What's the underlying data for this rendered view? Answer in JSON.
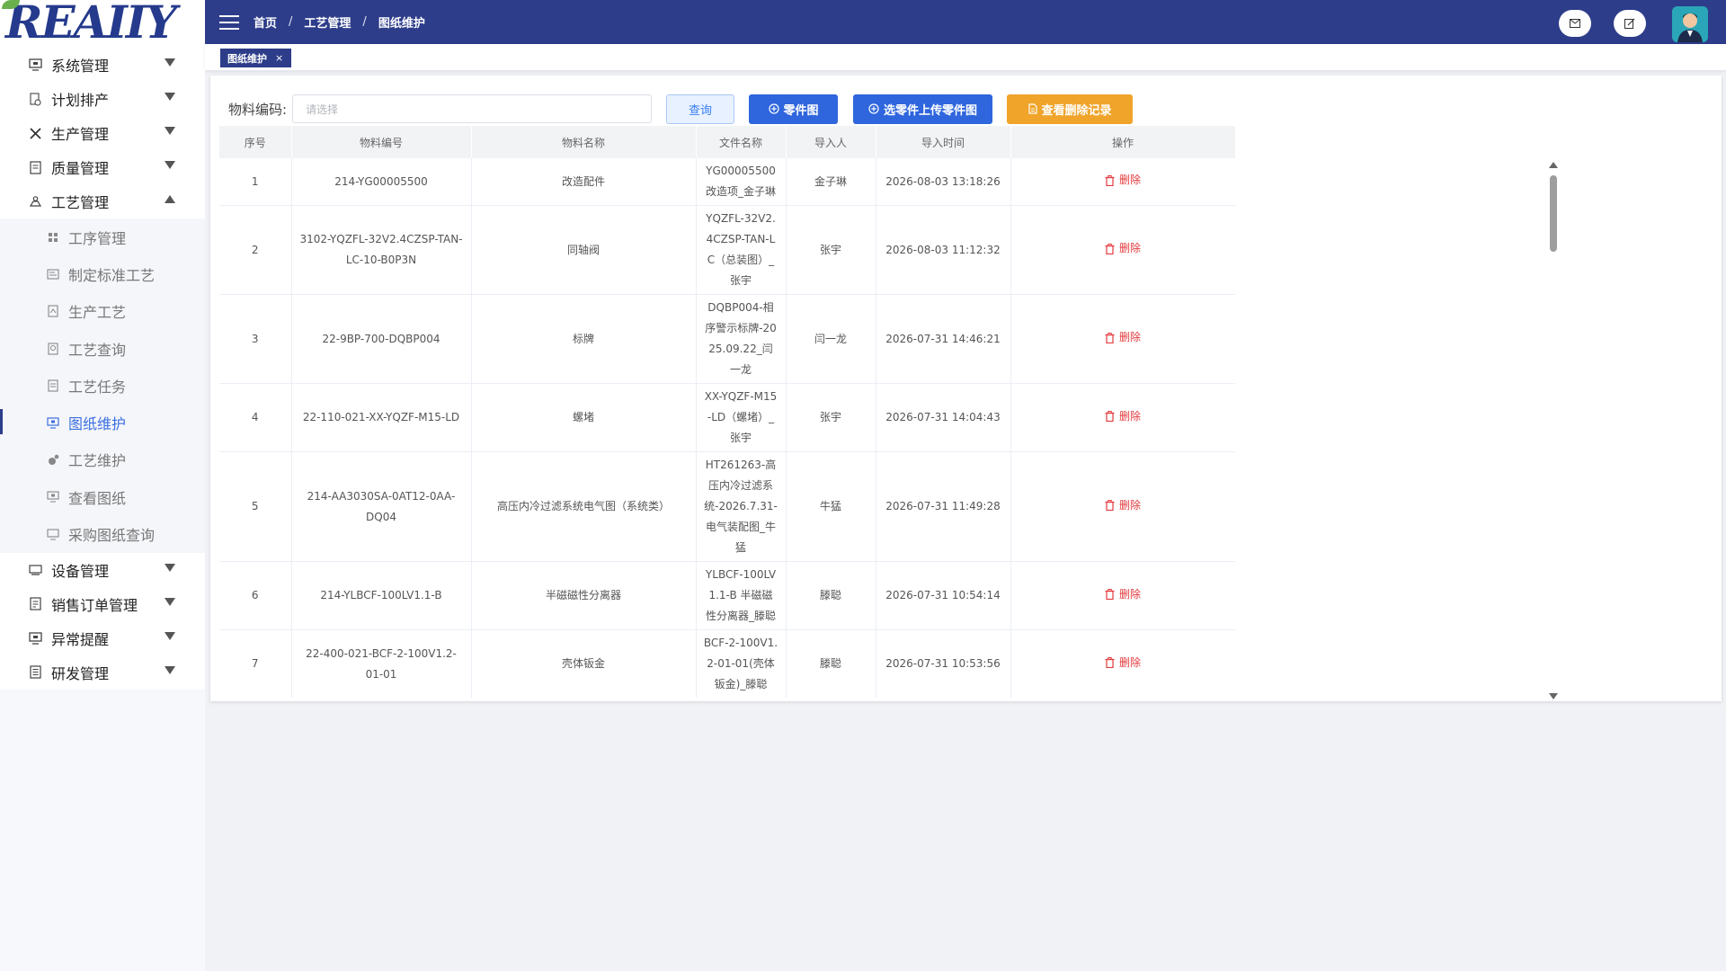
{
  "brand": {
    "logo_text": "REAIIY",
    "header_color": "#2d3d8a",
    "accent": "#2f66dd"
  },
  "sidebar": {
    "menus": [
      {
        "label": "系统管理",
        "icon": "monitor-icon"
      },
      {
        "label": "计划排产",
        "icon": "plan-icon"
      },
      {
        "label": "生产管理",
        "icon": "tools-icon"
      },
      {
        "label": "质量管理",
        "icon": "document-icon"
      },
      {
        "label": "工艺管理",
        "icon": "process-icon",
        "expanded": true
      }
    ],
    "sub_items": [
      {
        "label": "工序管理",
        "icon": "steps-icon"
      },
      {
        "label": "制定标准工艺",
        "icon": "standard-icon"
      },
      {
        "label": "生产工艺",
        "icon": "production-icon"
      },
      {
        "label": "工艺查询",
        "icon": "query-icon"
      },
      {
        "label": "工艺任务",
        "icon": "task-icon"
      },
      {
        "label": "图纸维护",
        "icon": "drawing-icon",
        "active": true
      },
      {
        "label": "工艺维护",
        "icon": "maintain-icon"
      },
      {
        "label": "查看图纸",
        "icon": "view-drawing-icon"
      },
      {
        "label": "采购图纸查询",
        "icon": "purchase-drawing-icon"
      }
    ],
    "menus_after": [
      {
        "label": "设备管理",
        "icon": "device-icon"
      },
      {
        "label": "销售订单管理",
        "icon": "order-icon"
      },
      {
        "label": "异常提醒",
        "icon": "alert-icon"
      },
      {
        "label": "研发管理",
        "icon": "rd-icon"
      }
    ]
  },
  "header": {
    "breadcrumb": [
      "首页",
      "工艺管理",
      "图纸维护"
    ],
    "separator": "/"
  },
  "tabs": [
    {
      "label": "图纸维护",
      "close": "×"
    }
  ],
  "toolbar": {
    "material_code_label": "物料编码:",
    "material_code_placeholder": "请选择",
    "query_label": "查询",
    "part_drawing_label": "零件图",
    "upload_label": "选零件上传零件图",
    "delete_record_label": "查看删除记录"
  },
  "table": {
    "columns": [
      "序号",
      "物料编号",
      "物料名称",
      "文件名称",
      "导入人",
      "导入时间",
      "操作"
    ],
    "delete_label": "删除",
    "rows": [
      {
        "no": "1",
        "code": "214-YG00005500",
        "name": "改造配件",
        "file": "YG00005500改造项_金子琳",
        "user": "金子琳",
        "time": "2026-08-03 13:18:26"
      },
      {
        "no": "2",
        "code": "3102-YQZFL-32V2.4CZSP-TAN-LC-10-B0P3N",
        "name": "同轴阀",
        "file": "YQZFL-32V2.4CZSP-TAN-LC（总装图）_张宇",
        "user": "张宇",
        "time": "2026-08-03 11:12:32"
      },
      {
        "no": "3",
        "code": "22-9BP-700-DQBP004",
        "name": "标牌",
        "file": "DQBP004-相序警示标牌-2025.09.22_闫一龙",
        "user": "闫一龙",
        "time": "2026-07-31 14:46:21"
      },
      {
        "no": "4",
        "code": "22-110-021-XX-YQZF-M15-LD",
        "name": "螺堵",
        "file": "XX-YQZF-M15-LD（螺堵）_张宇",
        "user": "张宇",
        "time": "2026-07-31 14:04:43"
      },
      {
        "no": "5",
        "code": "214-AA3030SA-0AT12-0AA-DQ04",
        "name": "高压内冷过滤系统电气图（系统类）",
        "file": "HT261263-高压内冷过滤系统-2026.7.31-电气装配图_牛猛",
        "user": "牛猛",
        "time": "2026-07-31 11:49:28"
      },
      {
        "no": "6",
        "code": "214-YLBCF-100LV1.1-B",
        "name": "半磁磁性分离器",
        "file": "YLBCF-100LV1.1-B 半磁磁性分离器_滕聪",
        "user": "滕聪",
        "time": "2026-07-31 10:54:14"
      },
      {
        "no": "7",
        "code": "22-400-021-BCF-2-100V1.2-01-01",
        "name": "壳体钣金",
        "file": "BCF-2-100V1.2-01-01(壳体钣金)_滕聪",
        "user": "滕聪",
        "time": "2026-07-31 10:53:56"
      }
    ]
  }
}
